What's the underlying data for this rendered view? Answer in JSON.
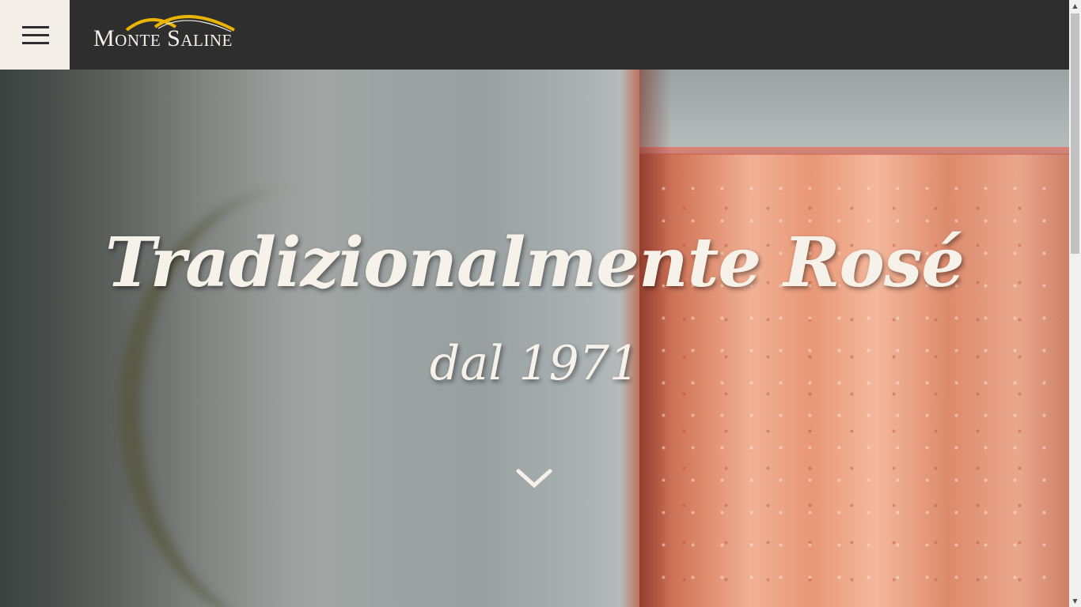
{
  "header": {
    "menu_icon": "hamburger-menu-icon",
    "logo_text": "Monte Saline",
    "logo_arc_color": "#e8b400"
  },
  "hero": {
    "title": "Tradizionalmente Rosé",
    "subtitle": "dal 1971",
    "scroll_icon": "chevron-down-icon"
  },
  "colors": {
    "header_bg": "#2e2e2e",
    "menu_bg": "#f3efe8",
    "text_light": "#f6f2ea"
  },
  "scrollbar": {
    "up_glyph": "▲",
    "down_glyph": "▼"
  }
}
